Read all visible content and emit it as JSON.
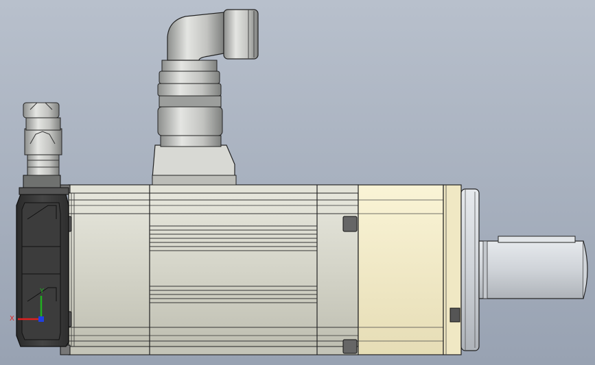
{
  "viewport": {
    "background_top": "#b8c0cc",
    "background_bottom": "#98a2b2"
  },
  "model": {
    "housing_color": "#d9d9cd",
    "flange_color": "#f3ecc8",
    "encoder_color": "#383838",
    "shaft_color": "#d3d7dc",
    "connector_color": "#c9cac6"
  },
  "triad": {
    "x_label": "X",
    "y_label": "Y",
    "x_color": "#e02020",
    "y_color": "#20b020",
    "z_color": "#2040e0"
  }
}
